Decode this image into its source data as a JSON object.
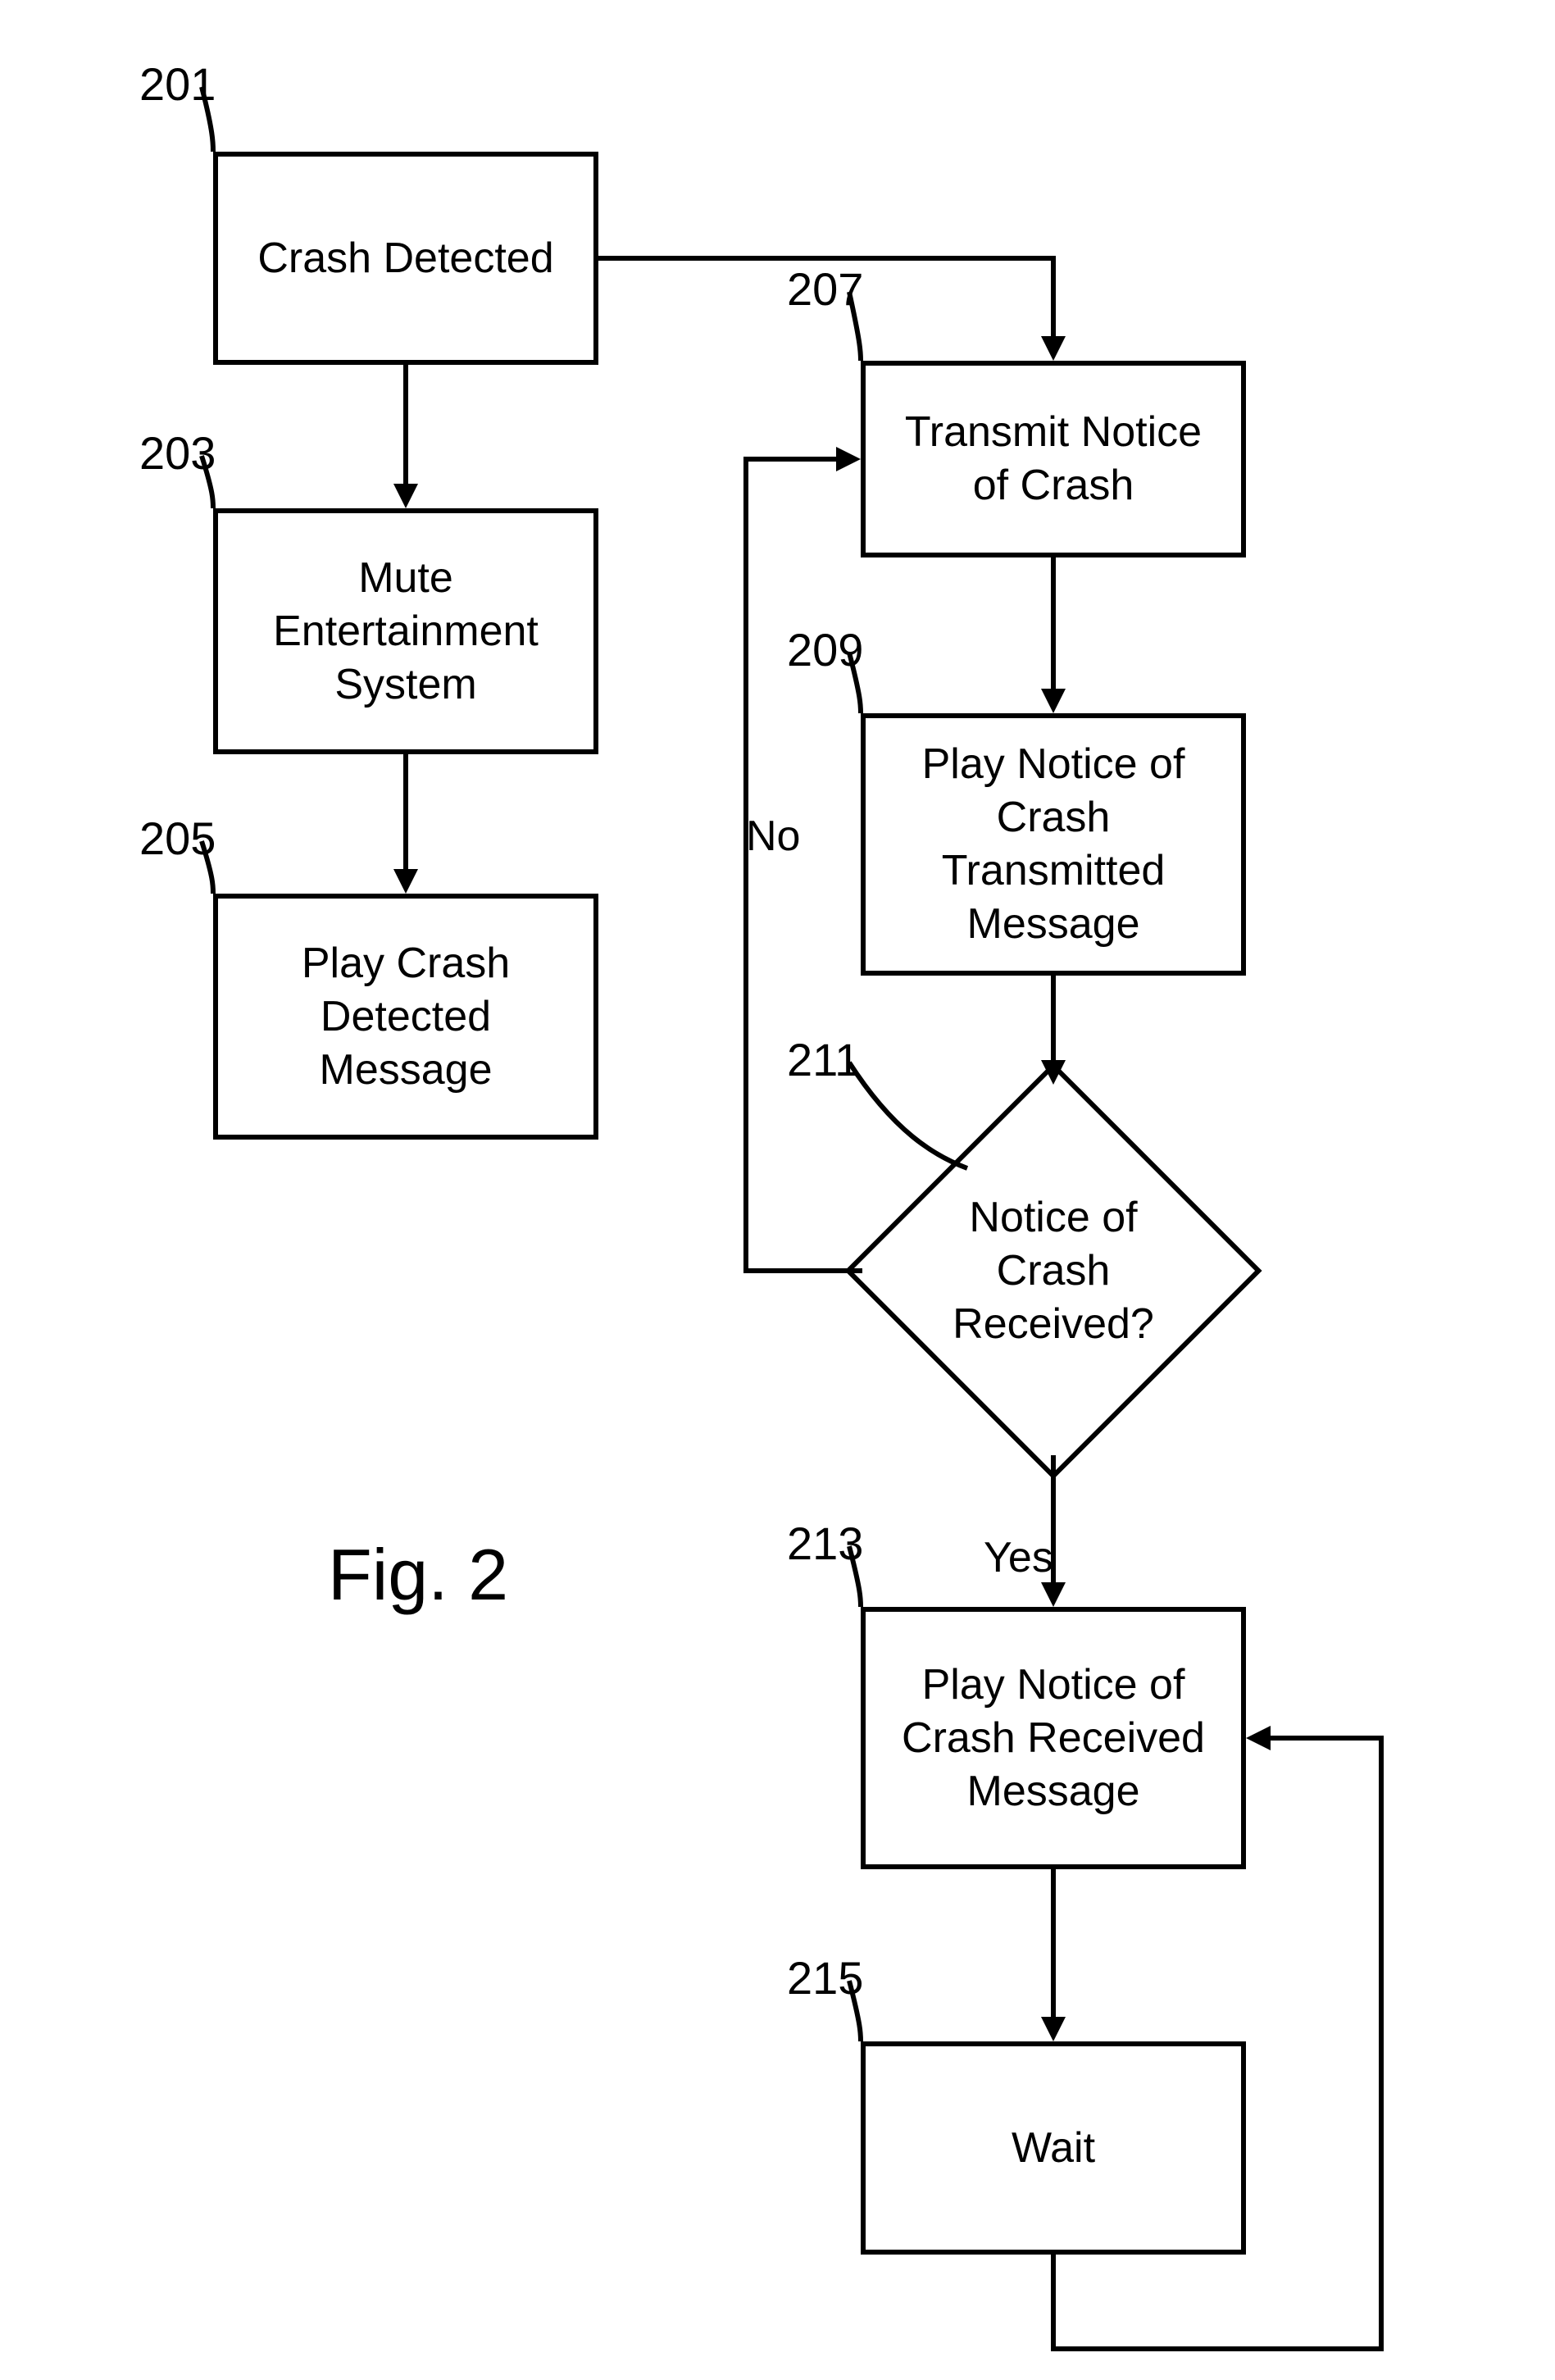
{
  "fig_label": "Fig. 2",
  "nodes": {
    "n201": {
      "ref": "201",
      "text": "Crash Detected"
    },
    "n203": {
      "ref": "203",
      "text": "Mute Entertainment System"
    },
    "n205": {
      "ref": "205",
      "text": "Play Crash Detected Message"
    },
    "n207": {
      "ref": "207",
      "text": "Transmit Notice of Crash"
    },
    "n209": {
      "ref": "209",
      "text": "Play Notice of Crash Transmitted Message"
    },
    "n211": {
      "ref": "211",
      "text": "Notice of Crash Received?"
    },
    "n213": {
      "ref": "213",
      "text": "Play Notice of Crash Received Message"
    },
    "n215": {
      "ref": "215",
      "text": "Wait"
    }
  },
  "edge_labels": {
    "no": "No",
    "yes": "Yes"
  }
}
